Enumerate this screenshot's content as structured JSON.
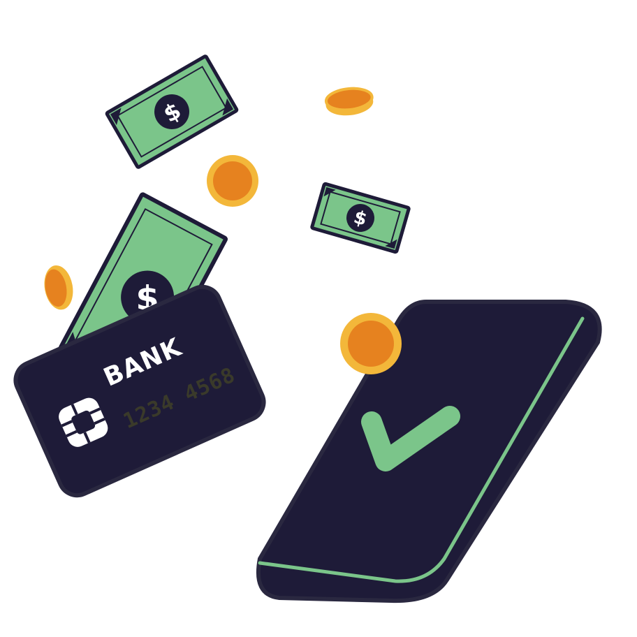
{
  "card": {
    "bank_label": "BANK",
    "number": "1234 4568"
  },
  "banknotes": {
    "currency_symbol": "$"
  },
  "colors": {
    "navy": "#1e1b38",
    "money_green": "#7bc58a",
    "coin_orange": "#e6821f",
    "coin_rim": "#f3b73a",
    "check_green": "#7bc58a"
  }
}
